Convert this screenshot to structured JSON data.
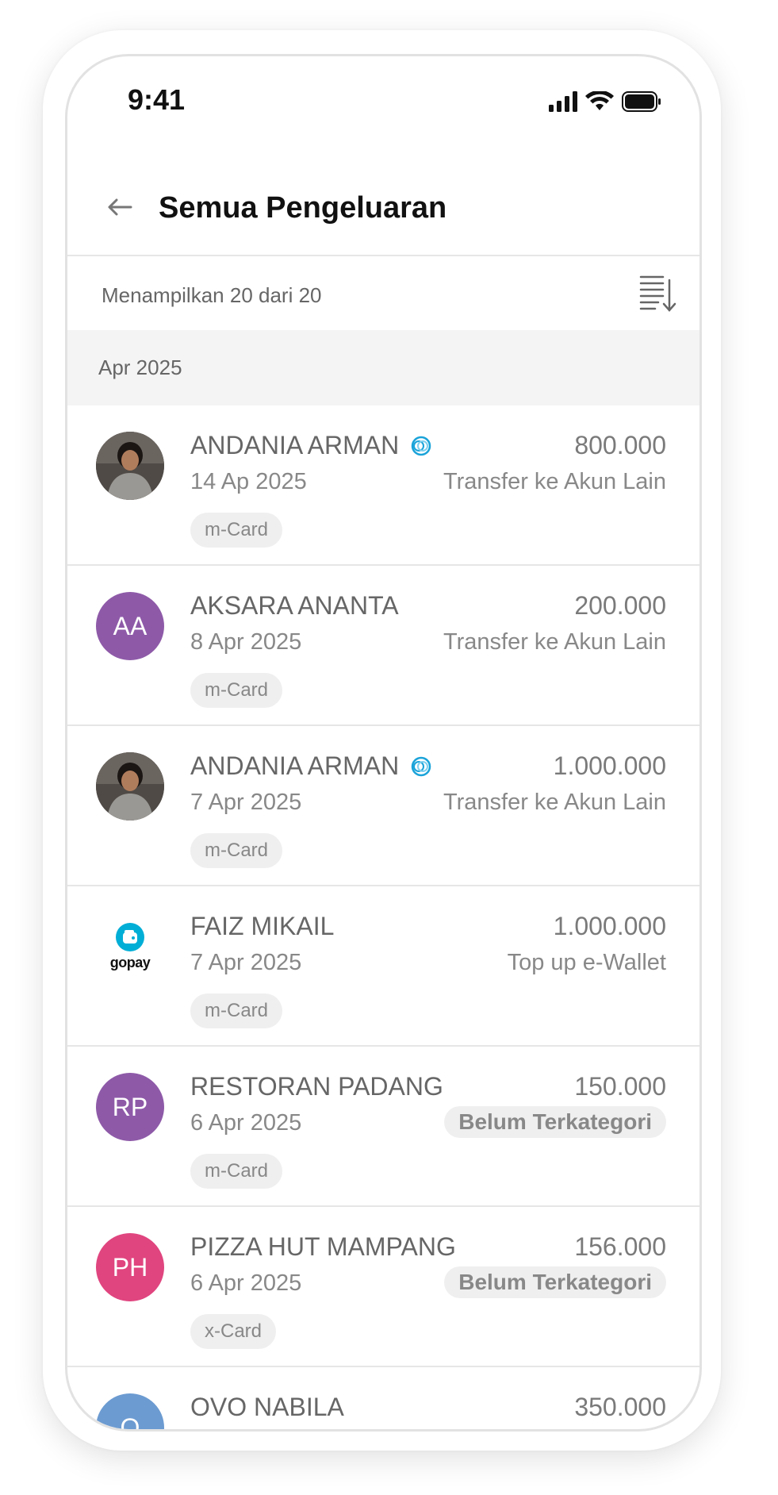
{
  "status_bar": {
    "time": "9:41"
  },
  "header": {
    "title": "Semua Pengeluaran"
  },
  "summary": {
    "text": "Menampilkan 20 dari 20"
  },
  "month_label": "Apr 2025",
  "transactions": [
    {
      "name": "ANDANIA ARMAN",
      "verified": true,
      "date": "14 Ap 2025",
      "amount": "800.000",
      "category": "Transfer ke Akun Lain",
      "card": "m-Card",
      "avatar": "photo"
    },
    {
      "name": "AKSARA ANANTA",
      "verified": false,
      "date": "8 Apr 2025",
      "amount": "200.000",
      "category": "Transfer ke Akun Lain",
      "card": "m-Card",
      "avatar": "AA",
      "avatar_color": "#8e5aa8"
    },
    {
      "name": "ANDANIA ARMAN",
      "verified": true,
      "date": "7 Apr 2025",
      "amount": "1.000.000",
      "category": "Transfer ke Akun Lain",
      "card": "m-Card",
      "avatar": "photo"
    },
    {
      "name": "FAIZ MIKAIL",
      "verified": false,
      "date": "7 Apr 2025",
      "amount": "1.000.000",
      "category": "Top up e-Wallet",
      "card": "m-Card",
      "avatar": "gopay",
      "avatar_text": "gopay"
    },
    {
      "name": "RESTORAN PADANG",
      "verified": false,
      "date": "6 Apr 2025",
      "amount": "150.000",
      "category": "Belum Terkategori",
      "card": "m-Card",
      "avatar": "RP",
      "avatar_color": "#8e5aa8"
    },
    {
      "name": "PIZZA HUT MAMPANG",
      "verified": false,
      "date": "6 Apr 2025",
      "amount": "156.000",
      "category": "Belum Terkategori",
      "card": "x-Card",
      "avatar": "PH",
      "avatar_color": "#e0457f"
    },
    {
      "name": "OVO NABILA",
      "verified": false,
      "date": "",
      "amount": "350.000",
      "category": "",
      "card": "",
      "avatar": "O",
      "avatar_color": "#6c9bd1"
    }
  ],
  "colors": {
    "accent_blue": "#1aa3d9",
    "gopay": "#00aed6"
  }
}
